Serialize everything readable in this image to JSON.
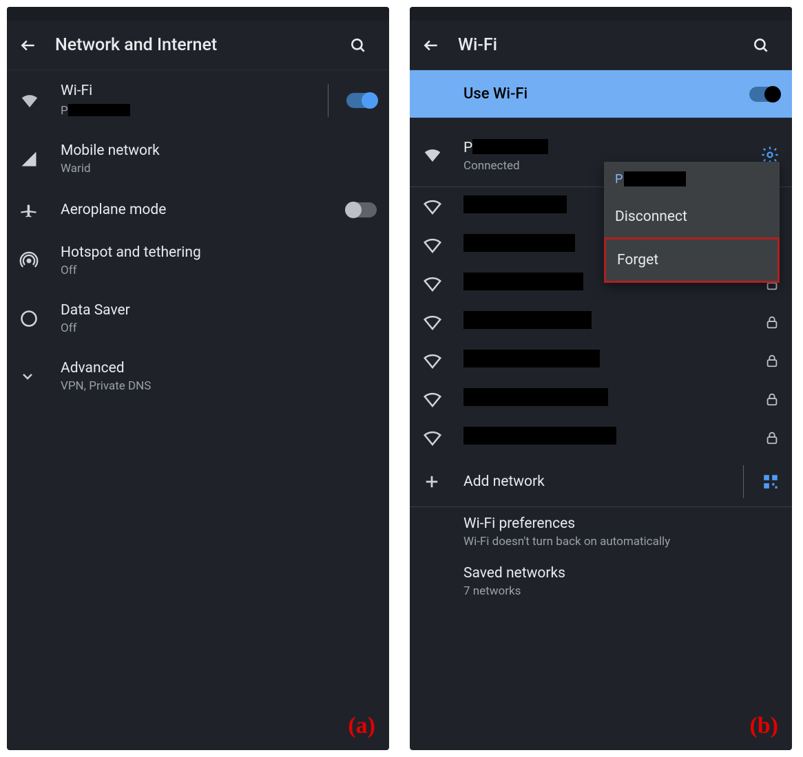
{
  "left": {
    "header": {
      "title": "Network and Internet"
    },
    "rows": {
      "wifi": {
        "title": "Wi‑Fi",
        "subtitle_prefix": "P",
        "toggle": "on"
      },
      "mobile": {
        "title": "Mobile network",
        "subtitle": "Warid"
      },
      "airplane": {
        "title": "Aeroplane mode",
        "toggle": "off"
      },
      "hotspot": {
        "title": "Hotspot and tethering",
        "subtitle": "Off"
      },
      "datasaver": {
        "title": "Data Saver",
        "subtitle": "Off"
      },
      "advanced": {
        "title": "Advanced",
        "subtitle": "VPN, Private DNS"
      }
    },
    "annotation": "(a)"
  },
  "right": {
    "header": {
      "title": "Wi‑Fi"
    },
    "banner": {
      "label": "Use Wi‑Fi",
      "toggle": "on"
    },
    "connected": {
      "ssid_prefix": "P",
      "status": "Connected"
    },
    "networks": [
      {
        "locked": false
      },
      {
        "locked": false
      },
      {
        "locked": true
      },
      {
        "locked": true
      },
      {
        "locked": true
      },
      {
        "locked": true
      },
      {
        "locked": true
      }
    ],
    "add_network": "Add network",
    "prefs": {
      "title": "Wi‑Fi preferences",
      "subtitle": "Wi‑Fi doesn't turn back on automatically"
    },
    "saved": {
      "title": "Saved networks",
      "subtitle": "7 networks"
    },
    "popup": {
      "title_prefix": "P",
      "disconnect": "Disconnect",
      "forget": "Forget"
    },
    "annotation": "(b)"
  }
}
